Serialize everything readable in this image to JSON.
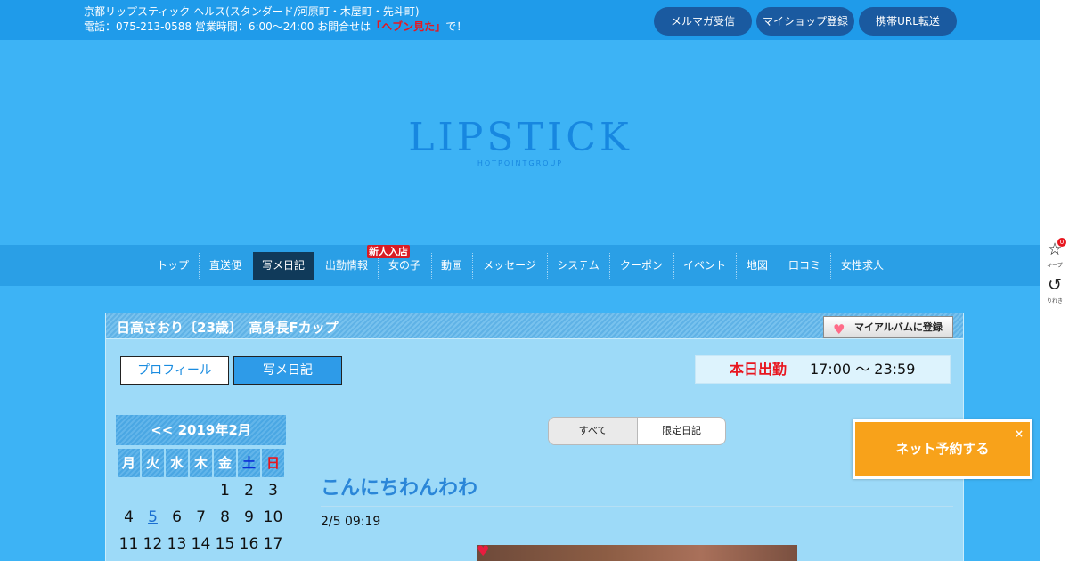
{
  "topbar": {
    "line1": "京都リップスティック ヘルス(スタンダード/河原町・木屋町・先斗町)",
    "line2_prefix": "電話：075-213-0588 営業時間：6:00～24:00 お問合せは",
    "line2_highlight": "「ヘブン見た」",
    "line2_suffix": "で！",
    "buttons": [
      "メルマガ受信",
      "マイショップ登録",
      "携帯URL転送"
    ]
  },
  "logo": {
    "name": "LIPSTICK",
    "sub": "HOTPOINTGROUP"
  },
  "nav": {
    "items": [
      "トップ",
      "直送便",
      "写メ日記",
      "出勤情報",
      "女の子",
      "動画",
      "メッセージ",
      "システム",
      "クーポン",
      "イベント",
      "地図",
      "口コミ",
      "女性求人"
    ],
    "active": "写メ日記",
    "badge": "新人入店"
  },
  "profile": {
    "title": "日高さおり〔23歳〕　高身長Fカップ",
    "album_button": "マイアルバムに登録",
    "tabs": [
      "プロフィール",
      "写メ日記"
    ],
    "today_label": "本日出勤",
    "today_time": "17:00 ～ 23:59"
  },
  "calendar": {
    "header": "<< 2019年2月",
    "weekdays": [
      "月",
      "火",
      "水",
      "木",
      "金",
      "土",
      "日"
    ],
    "rows": [
      [
        "",
        "",
        "",
        "",
        "1",
        "2",
        "3"
      ],
      [
        "4",
        "5",
        "6",
        "7",
        "8",
        "9",
        "10"
      ],
      [
        "11",
        "12",
        "13",
        "14",
        "15",
        "16",
        "17"
      ]
    ],
    "linked_day": "5"
  },
  "diary": {
    "filters": [
      "すべて",
      "限定日記"
    ],
    "post_title": "こんにちわんわわ",
    "post_date": "2/5 09:19"
  },
  "reserve": {
    "label": "ネット予約する",
    "close": "×"
  },
  "sidebar": {
    "keep_label": "キープ",
    "keep_count": "0",
    "history_label": "りれき"
  }
}
